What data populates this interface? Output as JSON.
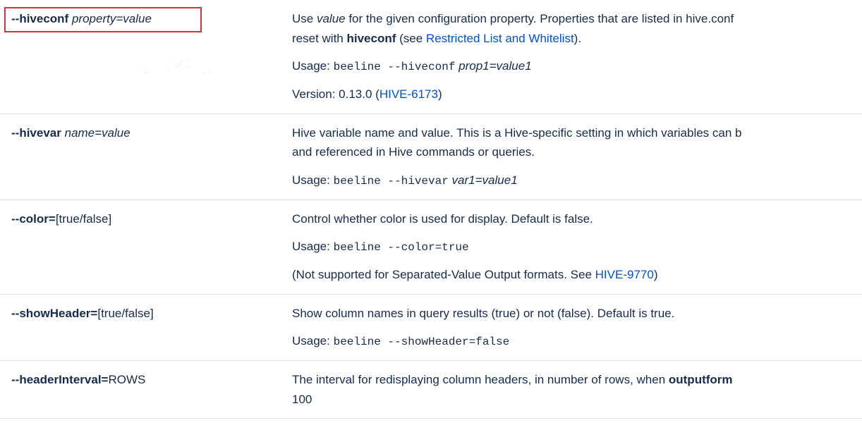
{
  "annotation": "配置参数",
  "rows": [
    {
      "opt_name": "--hiveconf",
      "opt_sep": " ",
      "opt_arg": "property=value",
      "highlight": true,
      "desc": {
        "p1_a": "Use ",
        "p1_em": "value",
        "p1_b": " for the given configuration property. Properties that are listed in hive.conf",
        "p2_a": "reset with ",
        "p2_strong": "hiveconf",
        "p2_b": " (see ",
        "p2_link": "Restricted List and Whitelist",
        "p2_c": ").",
        "usage_label": "Usage: ",
        "usage_code": "beeline --hiveconf",
        "usage_em": " prop1=value1",
        "version_a": "Version: 0.13.0 (",
        "version_link": "HIVE-6173",
        "version_b": ")"
      }
    },
    {
      "opt_name": "--hivevar",
      "opt_sep": " ",
      "opt_arg": "name=value",
      "desc": {
        "p1": "Hive variable name and value. This is a Hive-specific setting in which variables can b",
        "p2": "and referenced in Hive commands or queries.",
        "usage_label": "Usage: ",
        "usage_code": "beeline --hivevar",
        "usage_em": " var1=value1"
      }
    },
    {
      "opt_name": "--color=",
      "opt_sep": "",
      "opt_arg": "[true/false]",
      "desc": {
        "p1": "Control whether color is used for display. Default is false.",
        "usage_label": "Usage: ",
        "usage_code": "beeline --color=true",
        "p3_a": "(Not supported for Separated-Value Output formats. See ",
        "p3_link": "HIVE-9770",
        "p3_b": ")"
      }
    },
    {
      "opt_name": "--showHeader=",
      "opt_sep": "",
      "opt_arg": "[true/false]",
      "desc": {
        "p1": "Show column names in query results (true) or not (false). Default is true.",
        "usage_label": "Usage: ",
        "usage_code": "beeline --showHeader=false"
      }
    },
    {
      "opt_name": "--headerInterval=",
      "opt_sep": "",
      "opt_arg": "ROWS",
      "desc": {
        "p1_a": "The interval for redisplaying column headers, in number of rows, when ",
        "p1_strong": "outputform",
        "p2": "100"
      }
    }
  ]
}
